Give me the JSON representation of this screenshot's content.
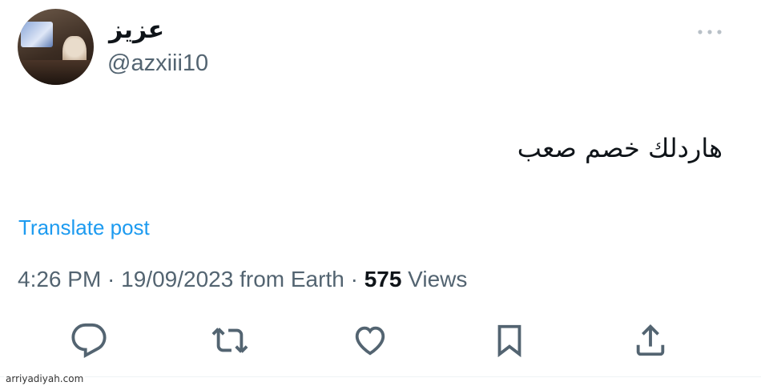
{
  "author": {
    "display_name": "عزيز",
    "handle": "@azxiii10"
  },
  "tweet": {
    "text": "هاردلك خصم صعب",
    "translate_label": "Translate post"
  },
  "meta": {
    "time": "4:26 PM",
    "separator1": " · ",
    "date": "19/09/2023",
    "source": " from Earth",
    "separator2": " · ",
    "views_count": "575",
    "views_label": " Views"
  },
  "actions": {
    "icons": [
      "reply-icon",
      "retweet-icon",
      "like-icon",
      "bookmark-icon",
      "share-icon"
    ]
  },
  "watermark": "arriyadiyah.com",
  "colors": {
    "text": "#0f1419",
    "secondary": "#536471",
    "link": "#1d9bf0"
  }
}
